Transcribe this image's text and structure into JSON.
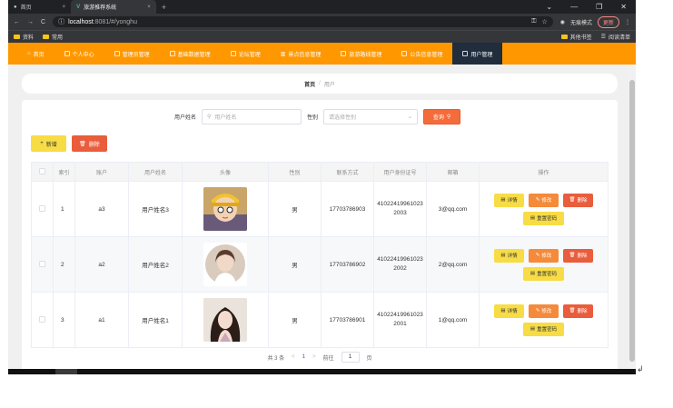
{
  "browser": {
    "tabs": [
      {
        "label": "首页",
        "close": "×"
      },
      {
        "label": "旅游推荐系统",
        "close": "×"
      }
    ],
    "new_tab": "+",
    "window_controls": [
      "⌄",
      "—",
      "❐",
      "✕"
    ],
    "url_host": "localhost",
    "url_path": ":8081/#/yonghu",
    "profile_label": "无痕模式",
    "update_label": "更新",
    "bookmarks": [
      {
        "label": "资料"
      },
      {
        "label": "常用"
      }
    ],
    "bookmarks_right": [
      {
        "label": "其他书签"
      },
      {
        "label": "阅读清单"
      }
    ]
  },
  "nav": {
    "items": [
      {
        "label": "首页",
        "icon": "home-icon"
      },
      {
        "label": "个人中心",
        "icon": "user-icon"
      },
      {
        "label": "管理员管理",
        "icon": "admin-icon"
      },
      {
        "label": "基础数据管理",
        "icon": "database-icon"
      },
      {
        "label": "论坛管理",
        "icon": "forum-icon"
      },
      {
        "label": "景点信息管理",
        "icon": "chart-icon"
      },
      {
        "label": "旅游路线管理",
        "icon": "route-icon"
      },
      {
        "label": "公告信息管理",
        "icon": "notice-icon"
      },
      {
        "label": "用户管理",
        "icon": "users-icon"
      }
    ],
    "active_index": 8,
    "accent": "#ff9800",
    "active_bg": "#1f2d3d"
  },
  "breadcrumb": {
    "home": "首页",
    "separator": "/",
    "current": "用户"
  },
  "search": {
    "name_label": "用户姓名",
    "name_placeholder": "用户姓名",
    "gender_label": "性别",
    "gender_placeholder": "请选择性别",
    "button_label": "查询"
  },
  "toolbar": {
    "add_label": "新增",
    "delete_label": "删除"
  },
  "table": {
    "headers": [
      "",
      "索引",
      "账户",
      "用户姓名",
      "头像",
      "性别",
      "联系方式",
      "用户身份证号",
      "邮箱",
      "操作"
    ],
    "rows": [
      {
        "index": "1",
        "account": "a3",
        "name": "用户姓名3",
        "gender": "男",
        "phone": "17703786903",
        "id_card": "410224199610232003",
        "email": "3@qq.com"
      },
      {
        "index": "2",
        "account": "a2",
        "name": "用户姓名2",
        "gender": "男",
        "phone": "17703786902",
        "id_card": "410224199610232002",
        "email": "2@qq.com"
      },
      {
        "index": "3",
        "account": "a1",
        "name": "用户姓名1",
        "gender": "男",
        "phone": "17703786901",
        "id_card": "410224199610232001",
        "email": "1@qq.com"
      }
    ],
    "ops": {
      "detail": "详情",
      "edit": "修改",
      "delete": "删除",
      "reset": "重置密码"
    }
  },
  "pager": {
    "total": "共 3 条",
    "prev": "<",
    "page": "1",
    "next": ">",
    "goto": "前往",
    "goto_value": "1",
    "unit": "页"
  }
}
